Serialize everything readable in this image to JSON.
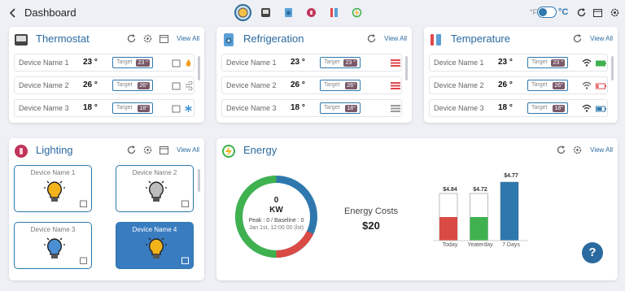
{
  "header": {
    "title": "Dashboard",
    "unit_f": "°F",
    "unit_c": "°C"
  },
  "thermostat": {
    "title": "Thermostat",
    "view_all": "View All",
    "rows": [
      {
        "name": "Device Name 1",
        "value": "23 °",
        "target_label": "Target",
        "target": "23 °",
        "mode": "flame-icon"
      },
      {
        "name": "Device Name 2",
        "value": "26 °",
        "target_label": "Target",
        "target": "26°",
        "mode": "fan-icon"
      },
      {
        "name": "Device Name 3",
        "value": "18 °",
        "target_label": "Target",
        "target": "18°",
        "mode": "snowflake-icon"
      }
    ]
  },
  "refrigeration": {
    "title": "Refrigeration",
    "view_all": "View All",
    "rows": [
      {
        "name": "Device Name 1",
        "value": "23 °",
        "target_label": "Target",
        "target": "23 °"
      },
      {
        "name": "Device Name 2",
        "value": "26 °",
        "target_label": "Target",
        "target": "26°"
      },
      {
        "name": "Device Name 3",
        "value": "18 °",
        "target_label": "Target",
        "target": "18°"
      }
    ],
    "status_colors": [
      "#e0474c",
      "#e0474c",
      "#9a9a9a"
    ]
  },
  "temperature": {
    "title": "Temperature",
    "view_all": "View All",
    "rows": [
      {
        "name": "Device Name 1",
        "value": "23 °",
        "target_label": "Target",
        "target": "23 °",
        "battery": "full"
      },
      {
        "name": "Device Name 2",
        "value": "26 °",
        "target_label": "Target",
        "target": "26°",
        "battery": "low"
      },
      {
        "name": "Device Name 3",
        "value": "18 °",
        "target_label": "Target",
        "target": "18°",
        "battery": "medium"
      }
    ]
  },
  "lighting": {
    "title": "Lighting",
    "view_all": "View All",
    "tiles": [
      {
        "name": "Device Name 1",
        "bulb_color": "#f3b31b",
        "active": false
      },
      {
        "name": "Device Name 2",
        "bulb_color": "#bdbdbd",
        "active": false
      },
      {
        "name": "Device Name 3",
        "bulb_color": "#4a8fd4",
        "active": false
      },
      {
        "name": "Device Name 4",
        "bulb_color": "#f3b31b",
        "active": true
      }
    ]
  },
  "energy": {
    "title": "Energy",
    "view_all": "View All",
    "gauge": {
      "value": "0",
      "unit": "KW",
      "peak_text": "Peak : 0 / Baseline : 0",
      "time_text": "Jan 1st, 12:00 00 (lst)"
    },
    "costs_label": "Energy Costs",
    "costs_value": "$20",
    "chart_data": {
      "type": "bar",
      "categories": [
        "Today",
        "Yeaterday",
        "7 Days"
      ],
      "values": [
        4.84,
        4.72,
        4.77
      ],
      "labels": [
        "$4.84",
        "$4.72",
        "$4.77"
      ],
      "fill_fraction": [
        0.5,
        0.5,
        1.0
      ],
      "colors": [
        "#d94a45",
        "#3fb24f",
        "#2f78ad"
      ]
    }
  },
  "colors": {
    "accent": "#2a6aa0",
    "bg": "#eef0f5"
  }
}
